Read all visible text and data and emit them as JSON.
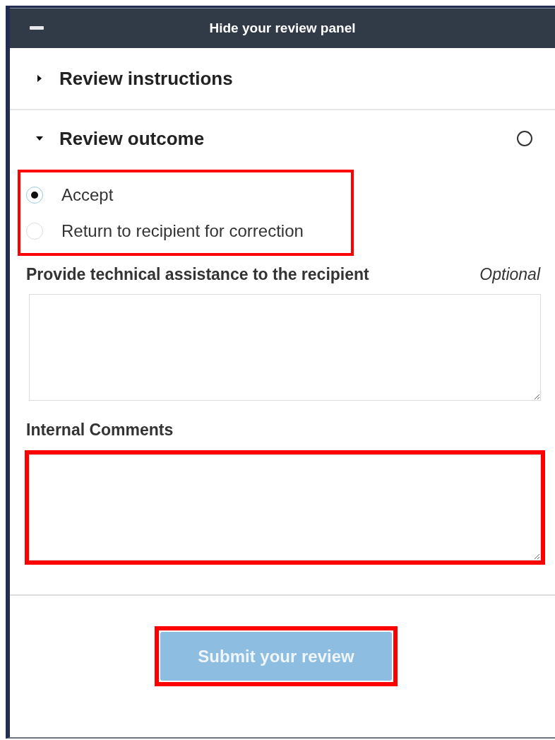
{
  "header": {
    "title": "Hide your review panel"
  },
  "sections": [
    {
      "title": "Review instructions",
      "expanded": false
    },
    {
      "title": "Review outcome",
      "expanded": true,
      "complete": false
    }
  ],
  "outcome": {
    "highlighted": true,
    "options": [
      {
        "label": "Accept",
        "selected": true
      },
      {
        "label": "Return to recipient for correction",
        "selected": false
      }
    ]
  },
  "fields": [
    {
      "label": "Provide technical assistance to the recipient",
      "note": "Optional",
      "highlighted": false
    },
    {
      "label": "Internal Comments",
      "highlighted": true
    }
  ],
  "submit": {
    "label": "Submit your review",
    "disabled": true,
    "highlighted": true
  }
}
